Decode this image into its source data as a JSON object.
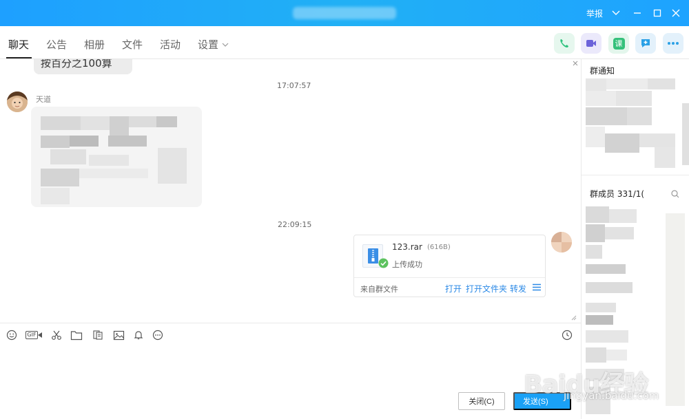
{
  "titlebar": {
    "report": "举报"
  },
  "tabs": [
    {
      "label": "聊天"
    },
    {
      "label": "公告"
    },
    {
      "label": "相册"
    },
    {
      "label": "文件"
    },
    {
      "label": "活动"
    },
    {
      "label": "设置"
    }
  ],
  "actions": {
    "course_label": "课"
  },
  "chat": {
    "prev_bubble_text": "按百分之100算",
    "messages": [
      {
        "time": "17:07:57",
        "sender": "天道"
      },
      {
        "time": "22:09:15"
      }
    ],
    "file": {
      "name": "123.rar",
      "size": "(616B)",
      "status": "上传成功",
      "source": "来自群文件",
      "actions": [
        "打开",
        "打开文件夹",
        "转发"
      ]
    }
  },
  "input": {
    "toolbar_gif": "GIF",
    "close_label": "关闭(C)",
    "send_label": "发送(S)"
  },
  "side": {
    "notice_title": "群通知",
    "members_title": "群成员 331/1("
  },
  "watermark": {
    "logo": "Baidu经验",
    "url": "jingyan.baidu.com"
  },
  "colors": {
    "accent": "#1aa1f6",
    "link": "#2b89e6",
    "success": "#5cc25e"
  }
}
